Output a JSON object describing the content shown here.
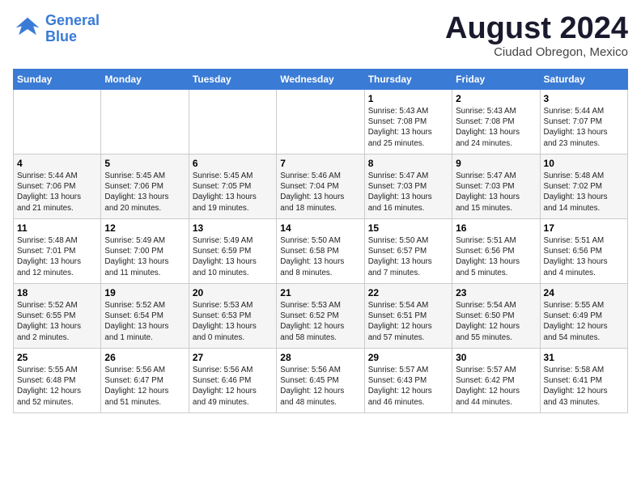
{
  "logo": {
    "line1": "General",
    "line2": "Blue"
  },
  "title": "August 2024",
  "subtitle": "Ciudad Obregon, Mexico",
  "days_header": [
    "Sunday",
    "Monday",
    "Tuesday",
    "Wednesday",
    "Thursday",
    "Friday",
    "Saturday"
  ],
  "weeks": [
    [
      {
        "num": "",
        "content": ""
      },
      {
        "num": "",
        "content": ""
      },
      {
        "num": "",
        "content": ""
      },
      {
        "num": "",
        "content": ""
      },
      {
        "num": "1",
        "content": "Sunrise: 5:43 AM\nSunset: 7:08 PM\nDaylight: 13 hours\nand 25 minutes."
      },
      {
        "num": "2",
        "content": "Sunrise: 5:43 AM\nSunset: 7:08 PM\nDaylight: 13 hours\nand 24 minutes."
      },
      {
        "num": "3",
        "content": "Sunrise: 5:44 AM\nSunset: 7:07 PM\nDaylight: 13 hours\nand 23 minutes."
      }
    ],
    [
      {
        "num": "4",
        "content": "Sunrise: 5:44 AM\nSunset: 7:06 PM\nDaylight: 13 hours\nand 21 minutes."
      },
      {
        "num": "5",
        "content": "Sunrise: 5:45 AM\nSunset: 7:06 PM\nDaylight: 13 hours\nand 20 minutes."
      },
      {
        "num": "6",
        "content": "Sunrise: 5:45 AM\nSunset: 7:05 PM\nDaylight: 13 hours\nand 19 minutes."
      },
      {
        "num": "7",
        "content": "Sunrise: 5:46 AM\nSunset: 7:04 PM\nDaylight: 13 hours\nand 18 minutes."
      },
      {
        "num": "8",
        "content": "Sunrise: 5:47 AM\nSunset: 7:03 PM\nDaylight: 13 hours\nand 16 minutes."
      },
      {
        "num": "9",
        "content": "Sunrise: 5:47 AM\nSunset: 7:03 PM\nDaylight: 13 hours\nand 15 minutes."
      },
      {
        "num": "10",
        "content": "Sunrise: 5:48 AM\nSunset: 7:02 PM\nDaylight: 13 hours\nand 14 minutes."
      }
    ],
    [
      {
        "num": "11",
        "content": "Sunrise: 5:48 AM\nSunset: 7:01 PM\nDaylight: 13 hours\nand 12 minutes."
      },
      {
        "num": "12",
        "content": "Sunrise: 5:49 AM\nSunset: 7:00 PM\nDaylight: 13 hours\nand 11 minutes."
      },
      {
        "num": "13",
        "content": "Sunrise: 5:49 AM\nSunset: 6:59 PM\nDaylight: 13 hours\nand 10 minutes."
      },
      {
        "num": "14",
        "content": "Sunrise: 5:50 AM\nSunset: 6:58 PM\nDaylight: 13 hours\nand 8 minutes."
      },
      {
        "num": "15",
        "content": "Sunrise: 5:50 AM\nSunset: 6:57 PM\nDaylight: 13 hours\nand 7 minutes."
      },
      {
        "num": "16",
        "content": "Sunrise: 5:51 AM\nSunset: 6:56 PM\nDaylight: 13 hours\nand 5 minutes."
      },
      {
        "num": "17",
        "content": "Sunrise: 5:51 AM\nSunset: 6:56 PM\nDaylight: 13 hours\nand 4 minutes."
      }
    ],
    [
      {
        "num": "18",
        "content": "Sunrise: 5:52 AM\nSunset: 6:55 PM\nDaylight: 13 hours\nand 2 minutes."
      },
      {
        "num": "19",
        "content": "Sunrise: 5:52 AM\nSunset: 6:54 PM\nDaylight: 13 hours\nand 1 minute."
      },
      {
        "num": "20",
        "content": "Sunrise: 5:53 AM\nSunset: 6:53 PM\nDaylight: 13 hours\nand 0 minutes."
      },
      {
        "num": "21",
        "content": "Sunrise: 5:53 AM\nSunset: 6:52 PM\nDaylight: 12 hours\nand 58 minutes."
      },
      {
        "num": "22",
        "content": "Sunrise: 5:54 AM\nSunset: 6:51 PM\nDaylight: 12 hours\nand 57 minutes."
      },
      {
        "num": "23",
        "content": "Sunrise: 5:54 AM\nSunset: 6:50 PM\nDaylight: 12 hours\nand 55 minutes."
      },
      {
        "num": "24",
        "content": "Sunrise: 5:55 AM\nSunset: 6:49 PM\nDaylight: 12 hours\nand 54 minutes."
      }
    ],
    [
      {
        "num": "25",
        "content": "Sunrise: 5:55 AM\nSunset: 6:48 PM\nDaylight: 12 hours\nand 52 minutes."
      },
      {
        "num": "26",
        "content": "Sunrise: 5:56 AM\nSunset: 6:47 PM\nDaylight: 12 hours\nand 51 minutes."
      },
      {
        "num": "27",
        "content": "Sunrise: 5:56 AM\nSunset: 6:46 PM\nDaylight: 12 hours\nand 49 minutes."
      },
      {
        "num": "28",
        "content": "Sunrise: 5:56 AM\nSunset: 6:45 PM\nDaylight: 12 hours\nand 48 minutes."
      },
      {
        "num": "29",
        "content": "Sunrise: 5:57 AM\nSunset: 6:43 PM\nDaylight: 12 hours\nand 46 minutes."
      },
      {
        "num": "30",
        "content": "Sunrise: 5:57 AM\nSunset: 6:42 PM\nDaylight: 12 hours\nand 44 minutes."
      },
      {
        "num": "31",
        "content": "Sunrise: 5:58 AM\nSunset: 6:41 PM\nDaylight: 12 hours\nand 43 minutes."
      }
    ]
  ]
}
